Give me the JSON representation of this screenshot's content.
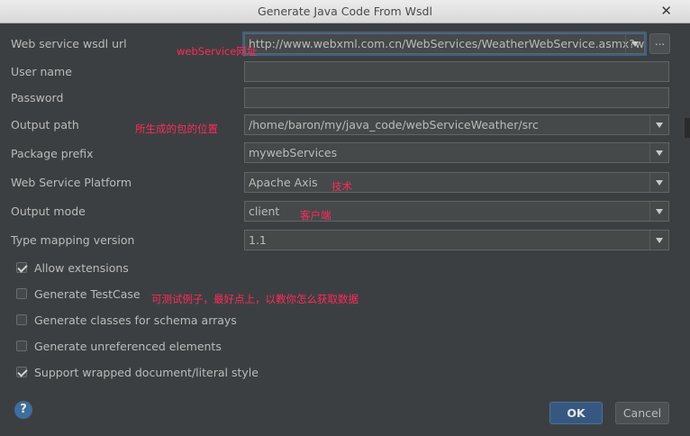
{
  "window": {
    "title": "Generate Java Code From Wsdl"
  },
  "form": {
    "wsdl_url": {
      "label": "Web service wsdl url",
      "value": "http://www.webxml.com.cn/WebServices/WeatherWebService.asmx?wsdl",
      "browse": "..."
    },
    "user_name": {
      "label": "User name",
      "value": ""
    },
    "password": {
      "label": "Password",
      "value": ""
    },
    "output_path": {
      "label": "Output path",
      "value": "/home/baron/my/java_code/webServiceWeather/src"
    },
    "package_prefix": {
      "label": "Package prefix",
      "value": "mywebServices"
    },
    "platform": {
      "label": "Web Service Platform",
      "value": "Apache Axis"
    },
    "output_mode": {
      "label": "Output mode",
      "value": "client"
    },
    "type_mapping": {
      "label": "Type mapping version",
      "value": "1.1"
    }
  },
  "options": [
    {
      "label": "Allow extensions",
      "checked": true
    },
    {
      "label": "Generate TestCase",
      "checked": false
    },
    {
      "label": "Generate classes for schema arrays",
      "checked": false
    },
    {
      "label": "Generate unreferenced elements",
      "checked": false
    },
    {
      "label": "Support wrapped document/literal style",
      "checked": true
    }
  ],
  "annotations": {
    "url": "webService网址",
    "output_path": "所生成的包的位置",
    "platform": "技术",
    "output_mode": "客户端",
    "testcase": "可测试例子，最好点上，以教你怎么获取数据"
  },
  "buttons": {
    "help": "?",
    "ok": "OK",
    "cancel": "Cancel"
  }
}
